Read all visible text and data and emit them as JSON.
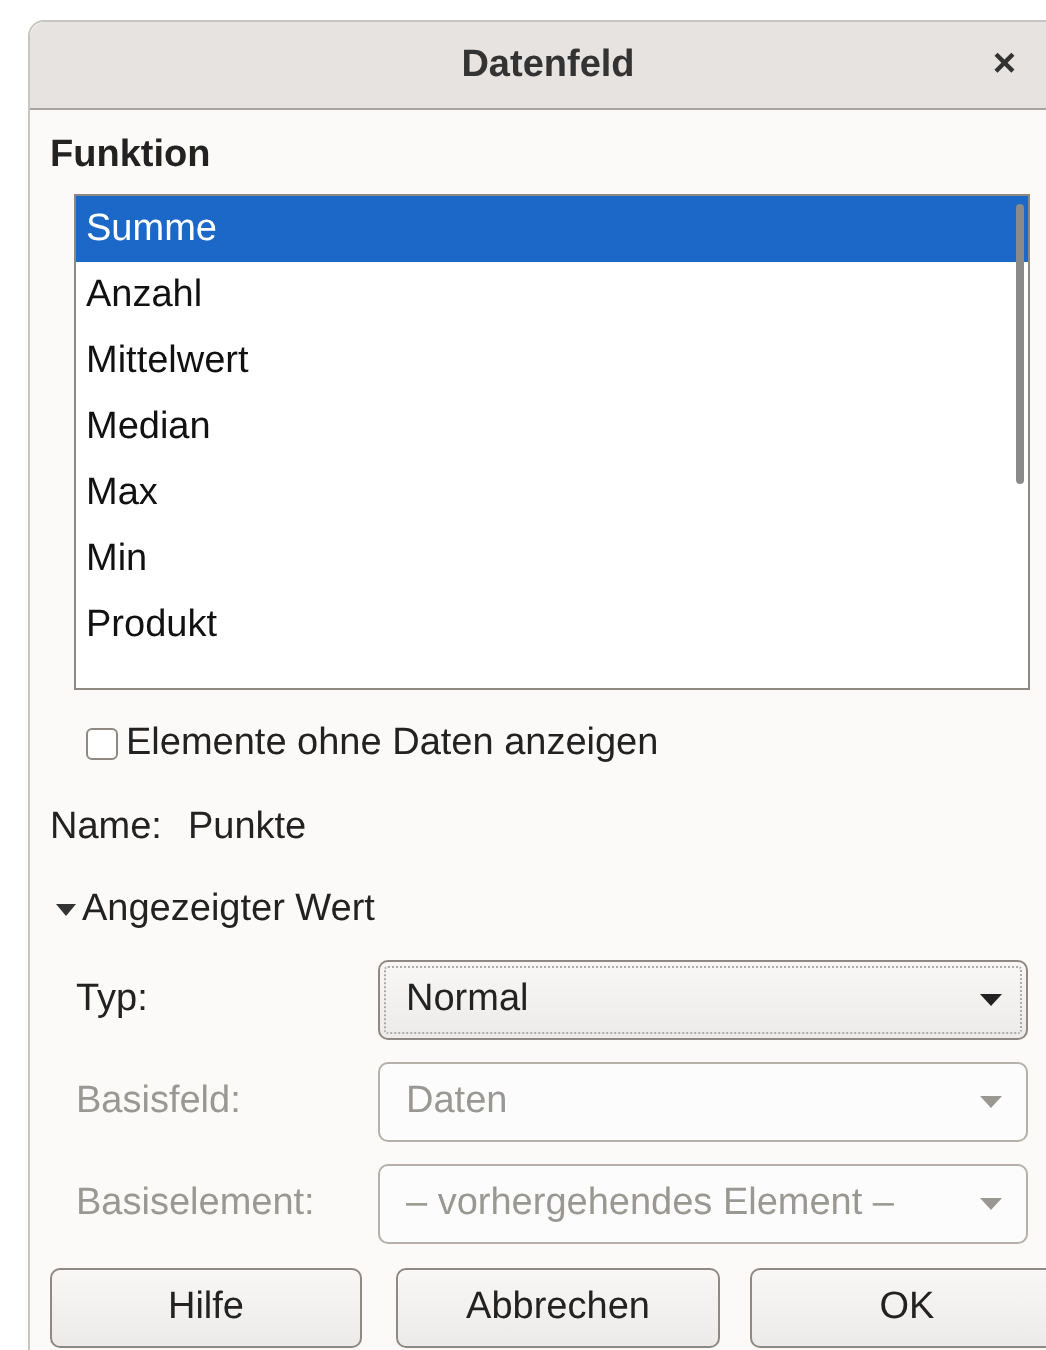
{
  "window": {
    "title": "Datenfeld",
    "close": "×"
  },
  "function": {
    "label": "Funktion",
    "items": [
      {
        "label": "Summe",
        "selected": true
      },
      {
        "label": "Anzahl",
        "selected": false
      },
      {
        "label": "Mittelwert",
        "selected": false
      },
      {
        "label": "Median",
        "selected": false
      },
      {
        "label": "Max",
        "selected": false
      },
      {
        "label": "Min",
        "selected": false
      },
      {
        "label": "Produkt",
        "selected": false
      }
    ]
  },
  "show_empty": {
    "label": "Elemente ohne Daten anzeigen",
    "checked": false
  },
  "name": {
    "label": "Name:",
    "value": "Punkte"
  },
  "displayed_value": {
    "label": "Angezeigter Wert",
    "expanded": true,
    "rows": [
      {
        "label": "Typ:",
        "value": "Normal",
        "disabled": false
      },
      {
        "label": "Basisfeld:",
        "value": "Daten",
        "disabled": true
      },
      {
        "label": "Basiselement:",
        "value": "– vorhergehendes Element –",
        "disabled": true
      }
    ]
  },
  "buttons": [
    "Hilfe",
    "Abbrechen",
    "OK"
  ]
}
